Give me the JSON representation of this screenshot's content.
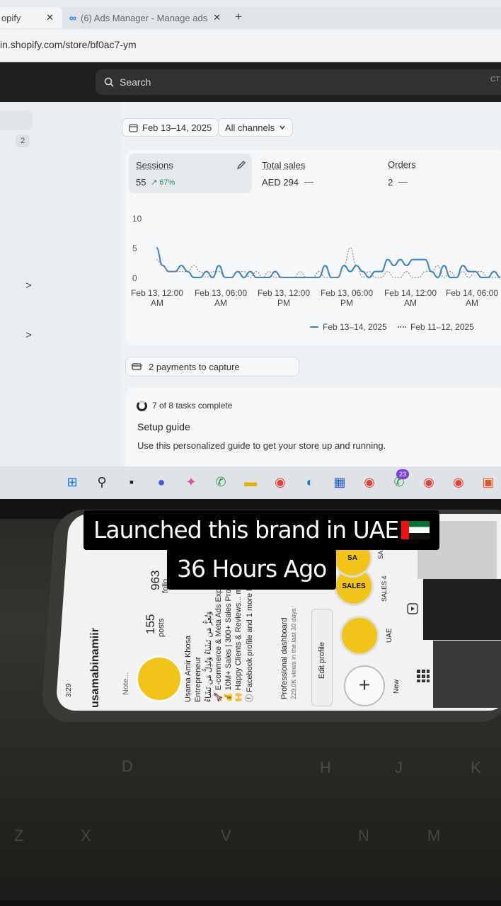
{
  "browser": {
    "tabs": [
      {
        "label": "opify",
        "close": "✕"
      },
      {
        "label": "(6) Ads Manager - Manage ads",
        "close": "✕"
      }
    ],
    "new_tab": "+",
    "url": "in.shopify.com/store/bf0ac7-ym"
  },
  "admin": {
    "search_placeholder": "Search",
    "search_shortcut": "CT",
    "sidebar_badge": "2",
    "sidebar_chevrons": [
      ">",
      ">"
    ]
  },
  "filters": {
    "date_range": "Feb 13–14, 2025",
    "channels": "All channels"
  },
  "metrics": {
    "sessions": {
      "label": "Sessions",
      "value": "55",
      "delta": "↗ 67%"
    },
    "total_sales": {
      "label": "Total sales",
      "value": "AED 294",
      "dash": "—"
    },
    "orders": {
      "label": "Orders",
      "value": "2",
      "dash": "—"
    }
  },
  "chart_data": {
    "type": "line",
    "y_ticks": [
      "10",
      "5",
      "0"
    ],
    "ylim": [
      0,
      10
    ],
    "x_ticks": [
      {
        "line1": "Feb 13, 12:00",
        "line2": "AM"
      },
      {
        "line1": "Feb 13, 06:00",
        "line2": "AM"
      },
      {
        "line1": "Feb 13, 12:00",
        "line2": "PM"
      },
      {
        "line1": "Feb 13, 06:00",
        "line2": "PM"
      },
      {
        "line1": "Feb 14, 12:00",
        "line2": "AM"
      },
      {
        "line1": "Feb 14, 06:00",
        "line2": "AM"
      }
    ],
    "series": [
      {
        "name": "Feb 13–14, 2025",
        "color": "#3b82c4",
        "style": "solid",
        "values": [
          5,
          2,
          1,
          1,
          2,
          1,
          0,
          0,
          1,
          0,
          2,
          0,
          0,
          1,
          0,
          1,
          0,
          0,
          0,
          1,
          0,
          0,
          0,
          0,
          0,
          0,
          0,
          2,
          0,
          0,
          2,
          1,
          2,
          1,
          0,
          1,
          1,
          3,
          2,
          3,
          2,
          3,
          3,
          3,
          1,
          0,
          2,
          0,
          0,
          2,
          1,
          1,
          0,
          0,
          1,
          0
        ]
      },
      {
        "name": "Feb 11–12, 2025",
        "color": "#888888",
        "style": "dotted",
        "values": [
          3,
          2,
          1,
          1,
          1,
          1,
          2,
          1,
          0,
          1,
          1,
          0,
          0,
          1,
          1,
          0,
          1,
          0,
          1,
          0,
          0,
          0,
          0,
          1,
          0,
          0,
          1,
          0,
          0,
          0,
          2,
          5,
          2,
          0,
          1,
          0,
          0,
          1,
          0,
          0,
          1,
          0,
          0,
          1,
          1,
          2,
          0,
          1,
          0,
          1,
          0,
          1,
          1,
          0,
          0,
          0
        ]
      }
    ]
  },
  "payments": {
    "label": "2 payments to capture"
  },
  "setup": {
    "progress": "7 of 8 tasks complete",
    "title": "Setup guide",
    "description": "Use this personalized guide to get your store up and running."
  },
  "taskbar": {
    "icons": [
      {
        "name": "windows-start-icon",
        "glyph": "⊞",
        "color": "#1a73e8"
      },
      {
        "name": "search-icon",
        "glyph": "⚲",
        "color": "#222"
      },
      {
        "name": "task-view-icon",
        "glyph": "▪",
        "color": "#222"
      },
      {
        "name": "meet-icon",
        "glyph": "●",
        "color": "#3f5bd9"
      },
      {
        "name": "copilot-icon",
        "glyph": "✦",
        "color": "#d44dab"
      },
      {
        "name": "whatsapp-icon",
        "glyph": "✆",
        "color": "#1b9b45"
      },
      {
        "name": "file-explorer-icon",
        "glyph": "▬",
        "color": "#e0b100"
      },
      {
        "name": "chrome-icon",
        "glyph": "◉",
        "color": "#db4437"
      },
      {
        "name": "edge-icon",
        "glyph": "◐",
        "color": "#0c7ad6"
      },
      {
        "name": "store-icon",
        "glyph": "▦",
        "color": "#2456c8"
      },
      {
        "name": "chrome-profile-icon",
        "glyph": "◉",
        "color": "#db4437"
      },
      {
        "name": "whatsapp-badge-icon",
        "glyph": "✆",
        "color": "#1b9b45"
      },
      {
        "name": "chrome-profile-2-icon",
        "glyph": "◉",
        "color": "#db4437"
      },
      {
        "name": "chrome-profile-3-icon",
        "glyph": "◉",
        "color": "#db4437"
      },
      {
        "name": "app-icon",
        "glyph": "▣",
        "color": "#e5582c"
      }
    ],
    "whatsapp_badge": "23"
  },
  "phone": {
    "time": "3:29",
    "username": "usamabinamiir",
    "posts_count": "155",
    "posts_label": "posts",
    "followers_count": "963",
    "followers_label": "follo",
    "note": "Note...",
    "bio": [
      "Usama Amir Khosa",
      "Entrepreneur",
      "وَتُعِزُّ مَن تَشَاءُ وَتُذِلُّ مَن تَشَاءُ",
      "🚀 E-commerce & Meta Ads Expe",
      "💰 10M+ Sales | 300+ Sales Proof",
      "🙌 Happy Clients & Reviews... mor",
      "ⓕ Facebook profile and 1 more lir"
    ],
    "dashboard_title": "Professional dashboard",
    "dashboard_sub": "229.0K views in the last 30 days",
    "edit_profile": "Edit profile",
    "highlights": [
      {
        "label": "New",
        "glyph": "+"
      },
      {
        "label": "UAE",
        "glyph": ""
      },
      {
        "label": "SALES 4",
        "glyph": "SALES"
      },
      {
        "label": "SA",
        "glyph": "SA"
      }
    ]
  },
  "keyboard_keys": [
    "D",
    "H",
    "J",
    "K",
    "Z",
    "X",
    "V",
    "N",
    "M"
  ],
  "caption": {
    "line1": "Launched this brand in UAE",
    "line2": "36 Hours Ago"
  }
}
